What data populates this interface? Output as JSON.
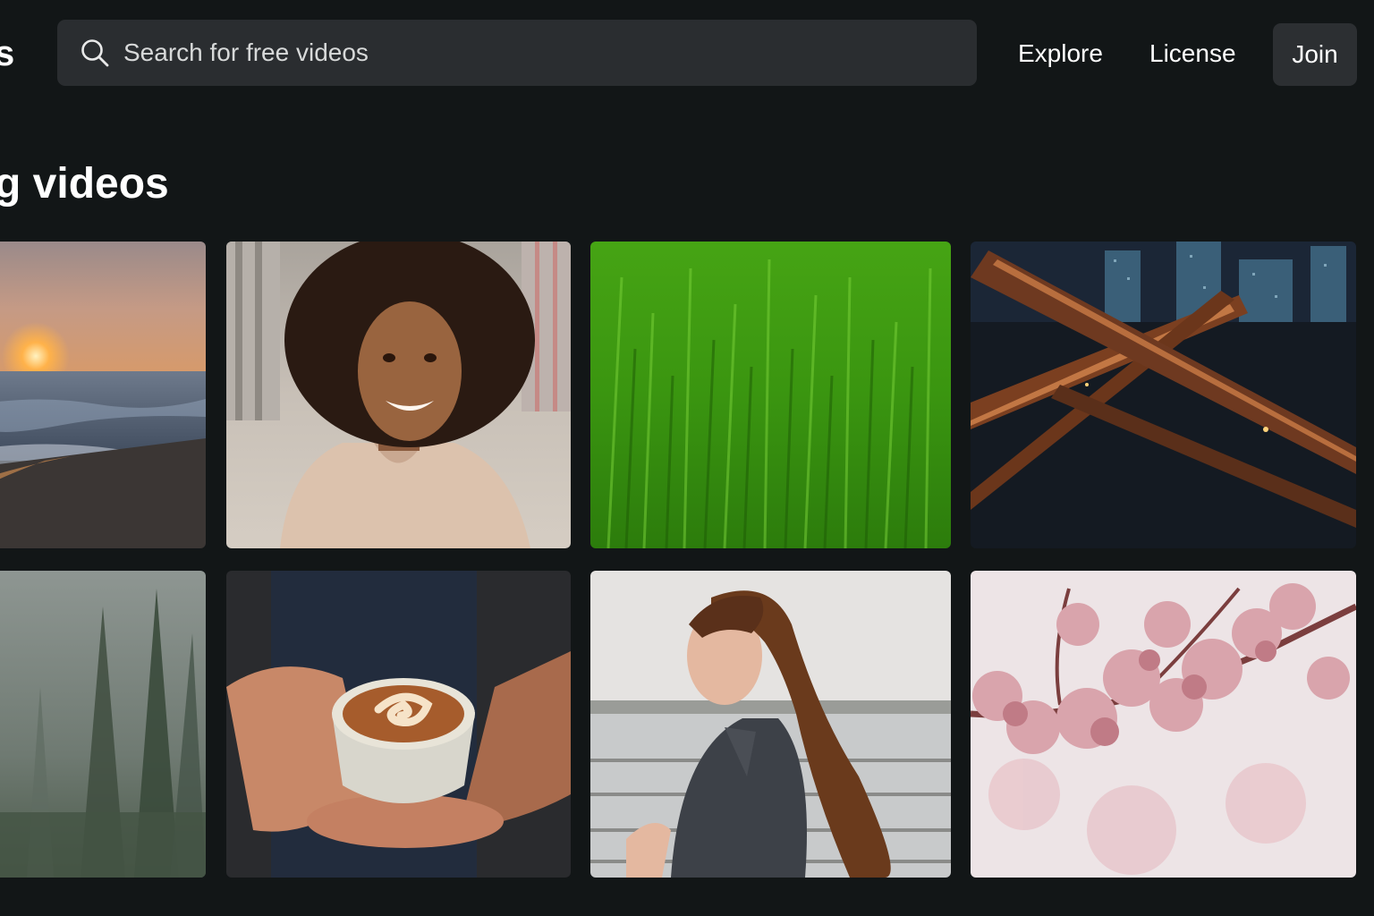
{
  "header": {
    "logo_fragment": "s",
    "search": {
      "placeholder": "Search for free videos",
      "icon": "search-icon"
    },
    "nav": {
      "explore": "Explore",
      "license": "License",
      "join": "Join"
    }
  },
  "section": {
    "title": "g videos"
  },
  "grid": {
    "tiles": [
      {
        "subject": "sunset-beach"
      },
      {
        "subject": "smiling-woman"
      },
      {
        "subject": "green-grass"
      },
      {
        "subject": "city-highway-night"
      },
      {
        "subject": "misty-forest"
      },
      {
        "subject": "latte-cup"
      },
      {
        "subject": "woman-ponytail-lake"
      },
      {
        "subject": "cherry-blossoms"
      }
    ]
  },
  "colors": {
    "background": "#121617",
    "search_bg": "#2a2d30",
    "button_bg": "#2c2f32",
    "text": "#ffffff"
  }
}
